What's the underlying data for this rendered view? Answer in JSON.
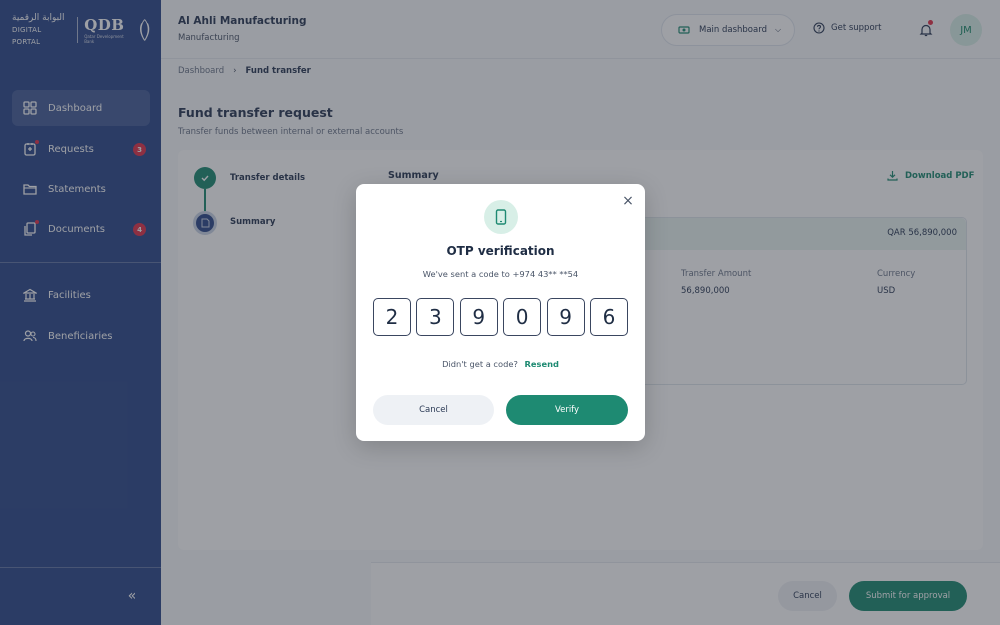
{
  "brand": {
    "arabic_name": "البوابة الرقمية",
    "portal_label": "DIGITAL PORTAL",
    "logo_text": "QDB",
    "logo_sub": "Qatar Development Bank"
  },
  "sidebar": {
    "items": [
      {
        "label": "Dashboard",
        "icon": "grid-icon",
        "active": true
      },
      {
        "label": "Requests",
        "icon": "requests-icon",
        "badge": "3"
      },
      {
        "label": "Statements",
        "icon": "folder-icon"
      },
      {
        "label": "Documents",
        "icon": "documents-icon",
        "badge": "4"
      },
      {
        "label": "Facilities",
        "icon": "bank-icon"
      },
      {
        "label": "Beneficiaries",
        "icon": "users-icon"
      }
    ],
    "collapse_symbol": "«"
  },
  "header": {
    "company_name": "Al Ahli Manufacturing",
    "company_sub": "Manufacturing",
    "dashboard_switch": "Main dashboard",
    "support": "Get support",
    "avatar_initials": "JM"
  },
  "breadcrumb": {
    "root": "Dashboard",
    "separator": "›",
    "current": "Fund transfer"
  },
  "page": {
    "title": "Fund transfer request",
    "subtitle": "Transfer funds between internal or external accounts"
  },
  "stepper": {
    "steps": [
      {
        "label": "Transfer details",
        "state": "done"
      },
      {
        "label": "Summary",
        "state": "current"
      }
    ]
  },
  "summary": {
    "title": "Summary",
    "download_label": "Download PDF",
    "head_amount": "QAR 56,890,000",
    "columns": [
      {
        "label": "Transfer Amount",
        "value": "56,890,000"
      },
      {
        "label": "Currency",
        "value": "USD"
      }
    ]
  },
  "footer": {
    "cancel": "Cancel",
    "submit": "Submit for approval"
  },
  "modal": {
    "title": "OTP verification",
    "subtitle_prefix": "We've sent a code to",
    "phone_masked": "+974 43** **54",
    "otp_digits": [
      "2",
      "3",
      "9",
      "0",
      "9",
      "6"
    ],
    "resend_prompt": "Didn't get a code?",
    "resend_link": "Resend",
    "cancel": "Cancel",
    "verify": "Verify",
    "close_symbol": "×"
  },
  "colors": {
    "sidebar_bg": "#2f4a8a",
    "accent_green": "#1e8a72",
    "badge_red": "#e2334b"
  }
}
